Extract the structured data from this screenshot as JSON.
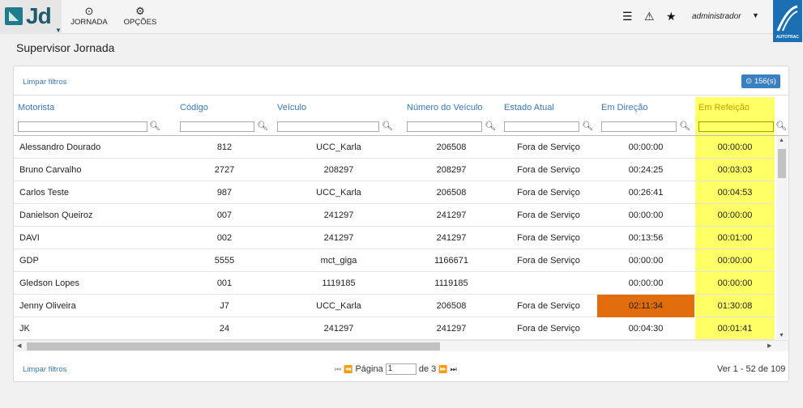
{
  "app": {
    "logo_text": "Jd",
    "nav": [
      {
        "label": "JORNADA",
        "icon": "clock-icon"
      },
      {
        "label": "OPÇÕES",
        "icon": "gears-icon"
      }
    ],
    "user": "administrador",
    "brand": "AUTOTRAC"
  },
  "page_title": "Supervisor Jornada",
  "toolbar": {
    "clear_filters": "Limpar filtros",
    "count_badge": "156(s)"
  },
  "columns": [
    "Motorista",
    "Código",
    "Veículo",
    "Número do Veículo",
    "Estado Atual",
    "Em Direção",
    "Em Refeição"
  ],
  "rows": [
    {
      "motorista": "Alessandro Dourado",
      "codigo": "812",
      "veiculo": "UCC_Karla",
      "numero": "206508",
      "estado": "Fora de Serviço",
      "direcao": "00:00:00",
      "refeicao": "00:00:00"
    },
    {
      "motorista": "Bruno Carvalho",
      "codigo": "2727",
      "veiculo": "208297",
      "numero": "208297",
      "estado": "Fora de Serviço",
      "direcao": "00:24:25",
      "refeicao": "00:03:03"
    },
    {
      "motorista": "Carlos Teste",
      "codigo": "987",
      "veiculo": "UCC_Karla",
      "numero": "206508",
      "estado": "Fora de Serviço",
      "direcao": "00:26:41",
      "refeicao": "00:04:53"
    },
    {
      "motorista": "Danielson Queiroz",
      "codigo": "007",
      "veiculo": "241297",
      "numero": "241297",
      "estado": "Fora de Serviço",
      "direcao": "00:00:00",
      "refeicao": "00:00:00"
    },
    {
      "motorista": "DAVI",
      "codigo": "002",
      "veiculo": "241297",
      "numero": "241297",
      "estado": "Fora de Serviço",
      "direcao": "00:13:56",
      "refeicao": "00:01:00"
    },
    {
      "motorista": "GDP",
      "codigo": "5555",
      "veiculo": "mct_giga",
      "numero": "1166671",
      "estado": "Fora de Serviço",
      "direcao": "00:00:00",
      "refeicao": "00:00:00"
    },
    {
      "motorista": "Gledson Lopes",
      "codigo": "001",
      "veiculo": "1119185",
      "numero": "1119185",
      "estado": "",
      "direcao": "00:00:00",
      "refeicao": "00:00:00"
    },
    {
      "motorista": "Jenny Oliveira",
      "codigo": "J7",
      "veiculo": "UCC_Karla",
      "numero": "206508",
      "estado": "Fora de Serviço",
      "direcao": "02:11:34",
      "refeicao": "01:30:08",
      "alert": true
    },
    {
      "motorista": "JK",
      "codigo": "24",
      "veiculo": "241297",
      "numero": "241297",
      "estado": "Fora de Serviço",
      "direcao": "00:04:30",
      "refeicao": "00:01:41"
    }
  ],
  "footer": {
    "clear_filters": "Limpar filtros",
    "page_label": "Página",
    "page_value": "1",
    "of_label": "de 3",
    "view_info": "Ver 1 - 52 de 109"
  },
  "colors": {
    "highlight": "#ffff66",
    "alert": "#e06c0c",
    "link": "#3a78b5",
    "brand": "#1b6fb3"
  }
}
